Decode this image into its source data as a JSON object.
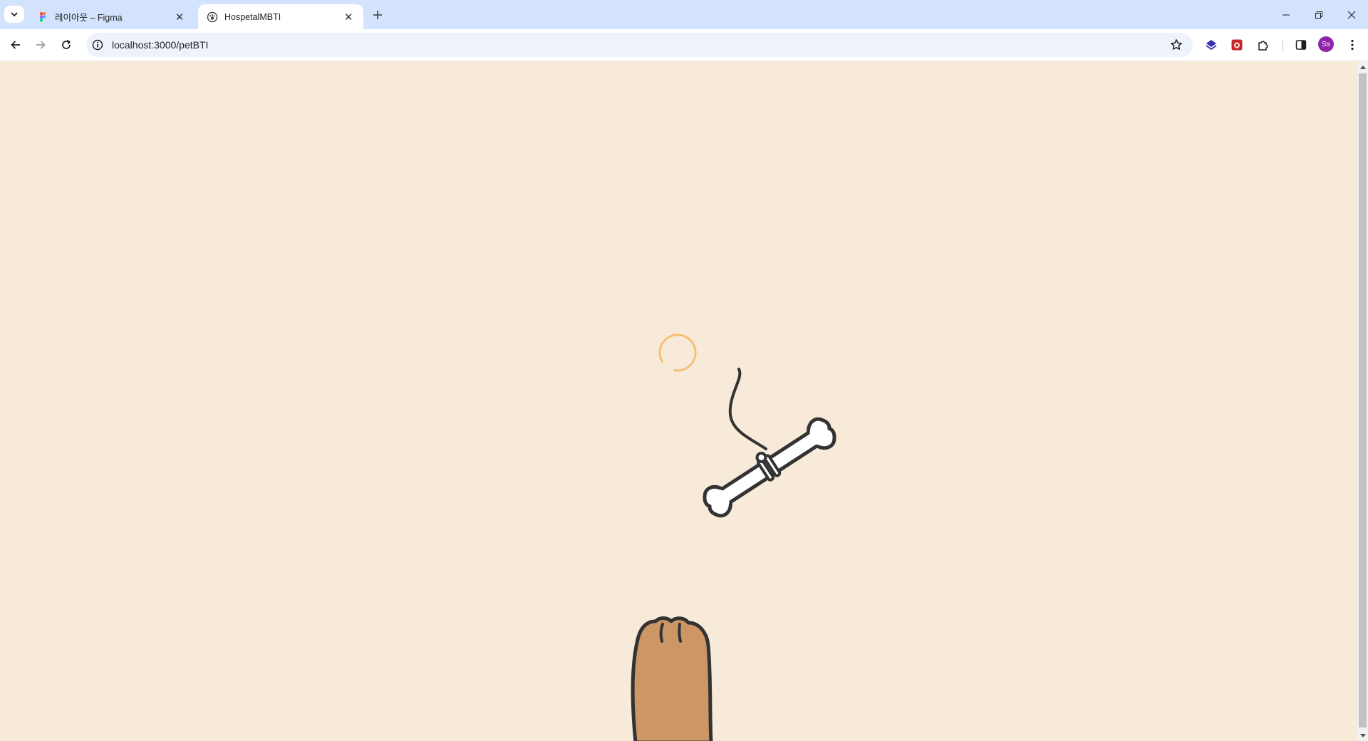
{
  "browser": {
    "tabs": [
      {
        "title": "레이아웃 – Figma",
        "icon": "figma-icon",
        "active": false
      },
      {
        "title": "HospetalMBTI",
        "icon": "paw-favicon-icon",
        "active": true
      }
    ],
    "address": {
      "url": "localhost:3000/petBTI"
    },
    "profile_initials": "Ss"
  },
  "page": {
    "loading": true,
    "illustrations": [
      "loading-spinner",
      "bone-on-string",
      "dog-paw"
    ]
  },
  "colors": {
    "tabstrip_bg": "#d3e3fd",
    "page_bg": "#f8ead8",
    "spinner": "#f7bf75",
    "paw_fill": "#cc9665",
    "outline": "#333333",
    "avatar_bg": "#8e24aa"
  }
}
